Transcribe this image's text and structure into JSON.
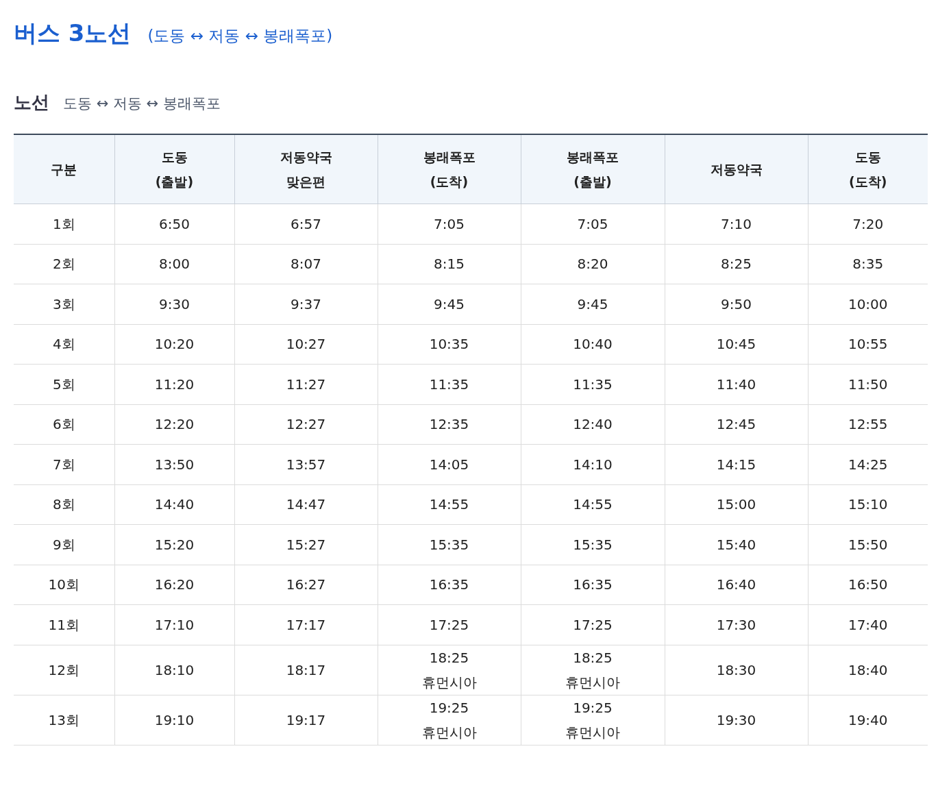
{
  "page_title": {
    "title": "버스 3노선",
    "subtitle": "(도동 ↔ 저동 ↔ 봉래폭포)"
  },
  "section": {
    "heading": "노선",
    "route": "도동 ↔ 저동 ↔ 봉래폭포"
  },
  "table": {
    "columns": [
      [
        "구분"
      ],
      [
        "도동",
        "(출발)"
      ],
      [
        "저동약국",
        "맞은편"
      ],
      [
        "봉래폭포",
        "(도착)"
      ],
      [
        "봉래폭포",
        "(출발)"
      ],
      [
        "저동약국"
      ],
      [
        "도동",
        "(도착)"
      ]
    ],
    "rows": [
      {
        "label": "1회",
        "times": [
          {
            "time": "6:50"
          },
          {
            "time": "6:57"
          },
          {
            "time": "7:05"
          },
          {
            "time": "7:05"
          },
          {
            "time": "7:10"
          },
          {
            "time": "7:20"
          }
        ]
      },
      {
        "label": "2회",
        "times": [
          {
            "time": "8:00"
          },
          {
            "time": "8:07"
          },
          {
            "time": "8:15"
          },
          {
            "time": "8:20"
          },
          {
            "time": "8:25"
          },
          {
            "time": "8:35"
          }
        ]
      },
      {
        "label": "3회",
        "times": [
          {
            "time": "9:30"
          },
          {
            "time": "9:37"
          },
          {
            "time": "9:45"
          },
          {
            "time": "9:45"
          },
          {
            "time": "9:50"
          },
          {
            "time": "10:00"
          }
        ]
      },
      {
        "label": "4회",
        "times": [
          {
            "time": "10:20"
          },
          {
            "time": "10:27"
          },
          {
            "time": "10:35"
          },
          {
            "time": "10:40"
          },
          {
            "time": "10:45"
          },
          {
            "time": "10:55"
          }
        ]
      },
      {
        "label": "5회",
        "times": [
          {
            "time": "11:20"
          },
          {
            "time": "11:27"
          },
          {
            "time": "11:35"
          },
          {
            "time": "11:35"
          },
          {
            "time": "11:40"
          },
          {
            "time": "11:50"
          }
        ]
      },
      {
        "label": "6회",
        "times": [
          {
            "time": "12:20"
          },
          {
            "time": "12:27"
          },
          {
            "time": "12:35"
          },
          {
            "time": "12:40"
          },
          {
            "time": "12:45"
          },
          {
            "time": "12:55"
          }
        ]
      },
      {
        "label": "7회",
        "times": [
          {
            "time": "13:50"
          },
          {
            "time": "13:57"
          },
          {
            "time": "14:05"
          },
          {
            "time": "14:10"
          },
          {
            "time": "14:15"
          },
          {
            "time": "14:25"
          }
        ]
      },
      {
        "label": "8회",
        "times": [
          {
            "time": "14:40"
          },
          {
            "time": "14:47"
          },
          {
            "time": "14:55"
          },
          {
            "time": "14:55"
          },
          {
            "time": "15:00"
          },
          {
            "time": "15:10"
          }
        ]
      },
      {
        "label": "9회",
        "times": [
          {
            "time": "15:20"
          },
          {
            "time": "15:27"
          },
          {
            "time": "15:35"
          },
          {
            "time": "15:35"
          },
          {
            "time": "15:40"
          },
          {
            "time": "15:50"
          }
        ]
      },
      {
        "label": "10회",
        "times": [
          {
            "time": "16:20"
          },
          {
            "time": "16:27"
          },
          {
            "time": "16:35"
          },
          {
            "time": "16:35"
          },
          {
            "time": "16:40"
          },
          {
            "time": "16:50"
          }
        ]
      },
      {
        "label": "11회",
        "times": [
          {
            "time": "17:10"
          },
          {
            "time": "17:17"
          },
          {
            "time": "17:25"
          },
          {
            "time": "17:25"
          },
          {
            "time": "17:30"
          },
          {
            "time": "17:40"
          }
        ]
      },
      {
        "label": "12회",
        "times": [
          {
            "time": "18:10"
          },
          {
            "time": "18:17"
          },
          {
            "time": "18:25",
            "note": "휴먼시아"
          },
          {
            "time": "18:25",
            "note": "휴먼시아"
          },
          {
            "time": "18:30"
          },
          {
            "time": "18:40"
          }
        ]
      },
      {
        "label": "13회",
        "times": [
          {
            "time": "19:10"
          },
          {
            "time": "19:17"
          },
          {
            "time": "19:25",
            "note": "휴먼시아"
          },
          {
            "time": "19:25",
            "note": "휴먼시아"
          },
          {
            "time": "19:30"
          },
          {
            "time": "19:40"
          }
        ]
      }
    ]
  }
}
